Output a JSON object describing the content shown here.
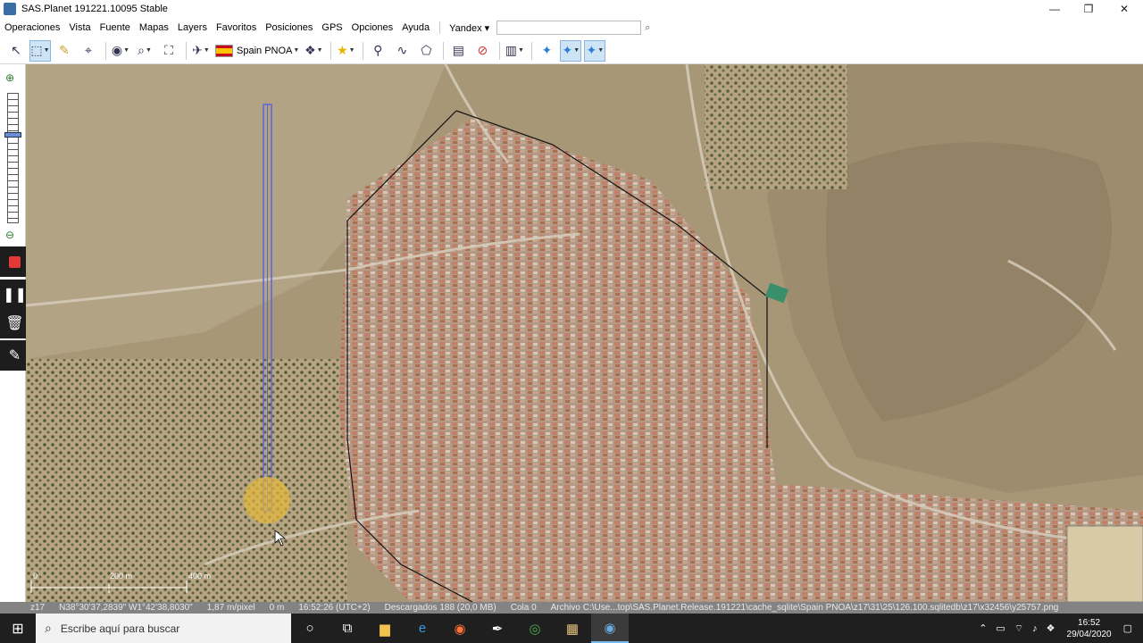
{
  "window": {
    "title": "SAS.Planet 191221.10095 Stable",
    "minimize": "—",
    "maximize": "❐",
    "close": "✕"
  },
  "menu": {
    "items": [
      "Operaciones",
      "Vista",
      "Fuente",
      "Mapas",
      "Layers",
      "Favoritos",
      "Posiciones",
      "GPS",
      "Opciones",
      "Ayuda"
    ],
    "search_provider": "Yandex",
    "search_value": ""
  },
  "toolbar": {
    "map_label": "Spain PNOA"
  },
  "scale": {
    "label_zero": "0",
    "label_200": "200 m",
    "label_400": "400 m"
  },
  "status": {
    "zoom": "z17",
    "coords": "N38°30'37,2839\" W1°42'38,8030\"",
    "resolution": "1,87 m/pixel",
    "distance": "0 m",
    "time": "16:52:26 (UTC+2)",
    "downloaded": "Descargados 188 (20,0 MB)",
    "queue": "Cola 0",
    "file": "Archivo C:\\Use...top\\SAS.Planet.Release.191221\\cache_sqlite\\Spain PNOA\\z17\\31\\25\\126.100.sqlitedb\\z17\\x32456\\y25757.png"
  },
  "taskbar": {
    "search_placeholder": "Escribe aquí para buscar",
    "time": "16:52",
    "date": "29/04/2020"
  },
  "colors": {
    "accent": "#cde4f7",
    "route": "#5a66d8",
    "record": "#e53935",
    "taskbar": "#1f1f1f"
  }
}
